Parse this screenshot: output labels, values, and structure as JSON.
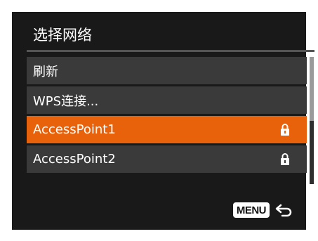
{
  "screen": {
    "title": "选择网络",
    "menu_items": [
      {
        "label": "刷新",
        "locked": false,
        "selected": false
      },
      {
        "label": "WPS连接...",
        "locked": false,
        "selected": false
      },
      {
        "label": "AccessPoint1",
        "locked": true,
        "selected": true
      },
      {
        "label": "AccessPoint2",
        "locked": true,
        "selected": false
      }
    ],
    "footer": {
      "menu_button_label": "MENU",
      "back_icon": "return-arrow-icon"
    },
    "colors": {
      "background": "#191919",
      "item_background": "#3a3a3a",
      "selected_background": "#e8620c",
      "text": "#ffffff"
    },
    "scrollbar": {
      "visible_fraction": 0.5,
      "position_fraction": 0
    }
  }
}
